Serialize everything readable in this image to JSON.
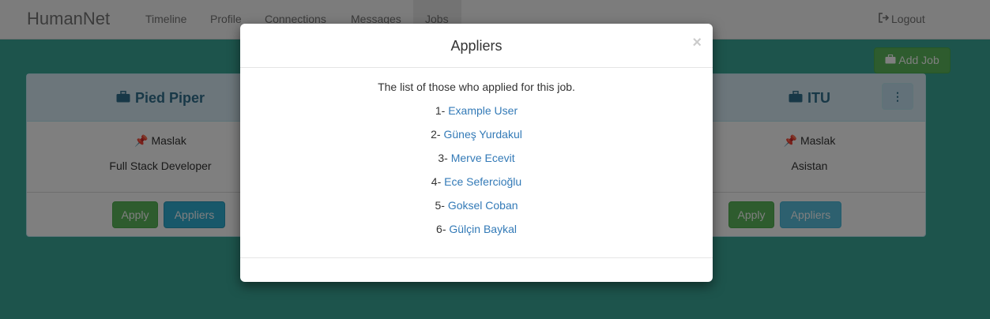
{
  "navbar": {
    "brand": "HumanNet",
    "links": [
      "Timeline",
      "Profile",
      "Connections",
      "Messages",
      "Jobs"
    ],
    "logout": "Logout"
  },
  "page": {
    "add_job": "Add Job",
    "cards": [
      {
        "company": "Pied Piper",
        "location": "Maslak",
        "title": "Full Stack Developer",
        "apply": "Apply",
        "appliers": "Appliers"
      },
      {
        "company": "ITU",
        "location": "Maslak",
        "title": "Asistan",
        "apply": "Apply",
        "appliers": "Appliers"
      }
    ]
  },
  "modal": {
    "title": "Appliers",
    "close": "×",
    "intro": "The list of those who applied for this job.",
    "applicants": [
      {
        "num": "1-",
        "name": "Example User"
      },
      {
        "num": "2-",
        "name": "Güneş Yurdakul"
      },
      {
        "num": "3-",
        "name": "Merve Ecevit"
      },
      {
        "num": "4-",
        "name": "Ece Sefercioğlu"
      },
      {
        "num": "5-",
        "name": "Goksel Coban"
      },
      {
        "num": "6-",
        "name": "Gülçin Baykal"
      }
    ]
  },
  "icons": {
    "briefcase": "briefcase-icon",
    "pin": "pushpin-icon",
    "logout": "logout-icon",
    "kebab": "more-vertical-icon"
  }
}
